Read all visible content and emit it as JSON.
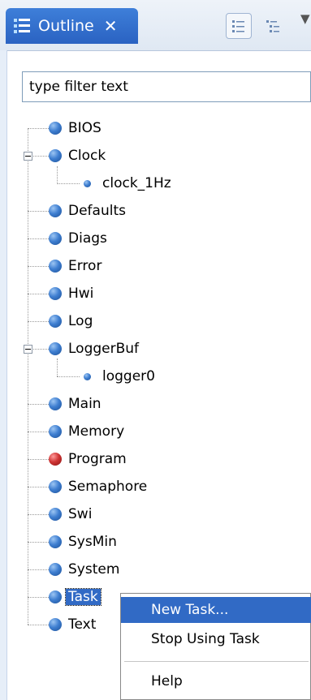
{
  "tab": {
    "title": "Outline",
    "close": "✕"
  },
  "toolbar": {
    "menu_arrow": "▼"
  },
  "filter": {
    "placeholder": "type filter text",
    "value": "type filter text"
  },
  "tree": {
    "items": [
      {
        "label": "BIOS"
      },
      {
        "label": "Clock",
        "expanded": true
      },
      {
        "label": "clock_1Hz",
        "child": true
      },
      {
        "label": "Defaults"
      },
      {
        "label": "Diags"
      },
      {
        "label": "Error"
      },
      {
        "label": "Hwi"
      },
      {
        "label": "Log"
      },
      {
        "label": "LoggerBuf",
        "expanded": true
      },
      {
        "label": "logger0",
        "child": true
      },
      {
        "label": "Main"
      },
      {
        "label": "Memory"
      },
      {
        "label": "Program",
        "status_color": "#cf3434"
      },
      {
        "label": "Semaphore"
      },
      {
        "label": "Swi"
      },
      {
        "label": "SysMin"
      },
      {
        "label": "System"
      },
      {
        "label": "Task",
        "selected": true
      },
      {
        "label": "Text"
      }
    ]
  },
  "context_menu": {
    "items": [
      {
        "label": "New Task..."
      },
      {
        "label": "Stop Using Task"
      },
      {
        "label": "Help"
      }
    ]
  },
  "colors": {
    "accent": "#316ac5",
    "tab": "#2a62c2"
  }
}
